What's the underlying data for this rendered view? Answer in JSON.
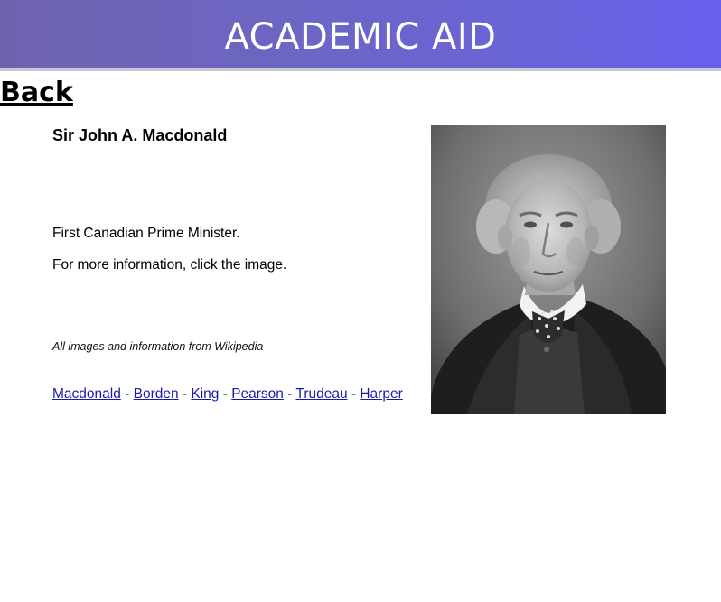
{
  "header": {
    "title": "ACADEMIC AID"
  },
  "back_link": "Back",
  "person": {
    "name": "Sir John A. Macdonald",
    "description": "First Canadian Prime Minister.",
    "more_info": "For more information, click the image."
  },
  "credit": "All images and information from Wikipedia",
  "nav": {
    "links": [
      "Macdonald",
      "Borden",
      "King",
      "Pearson",
      "Trudeau",
      "Harper"
    ],
    "separator": " - "
  }
}
